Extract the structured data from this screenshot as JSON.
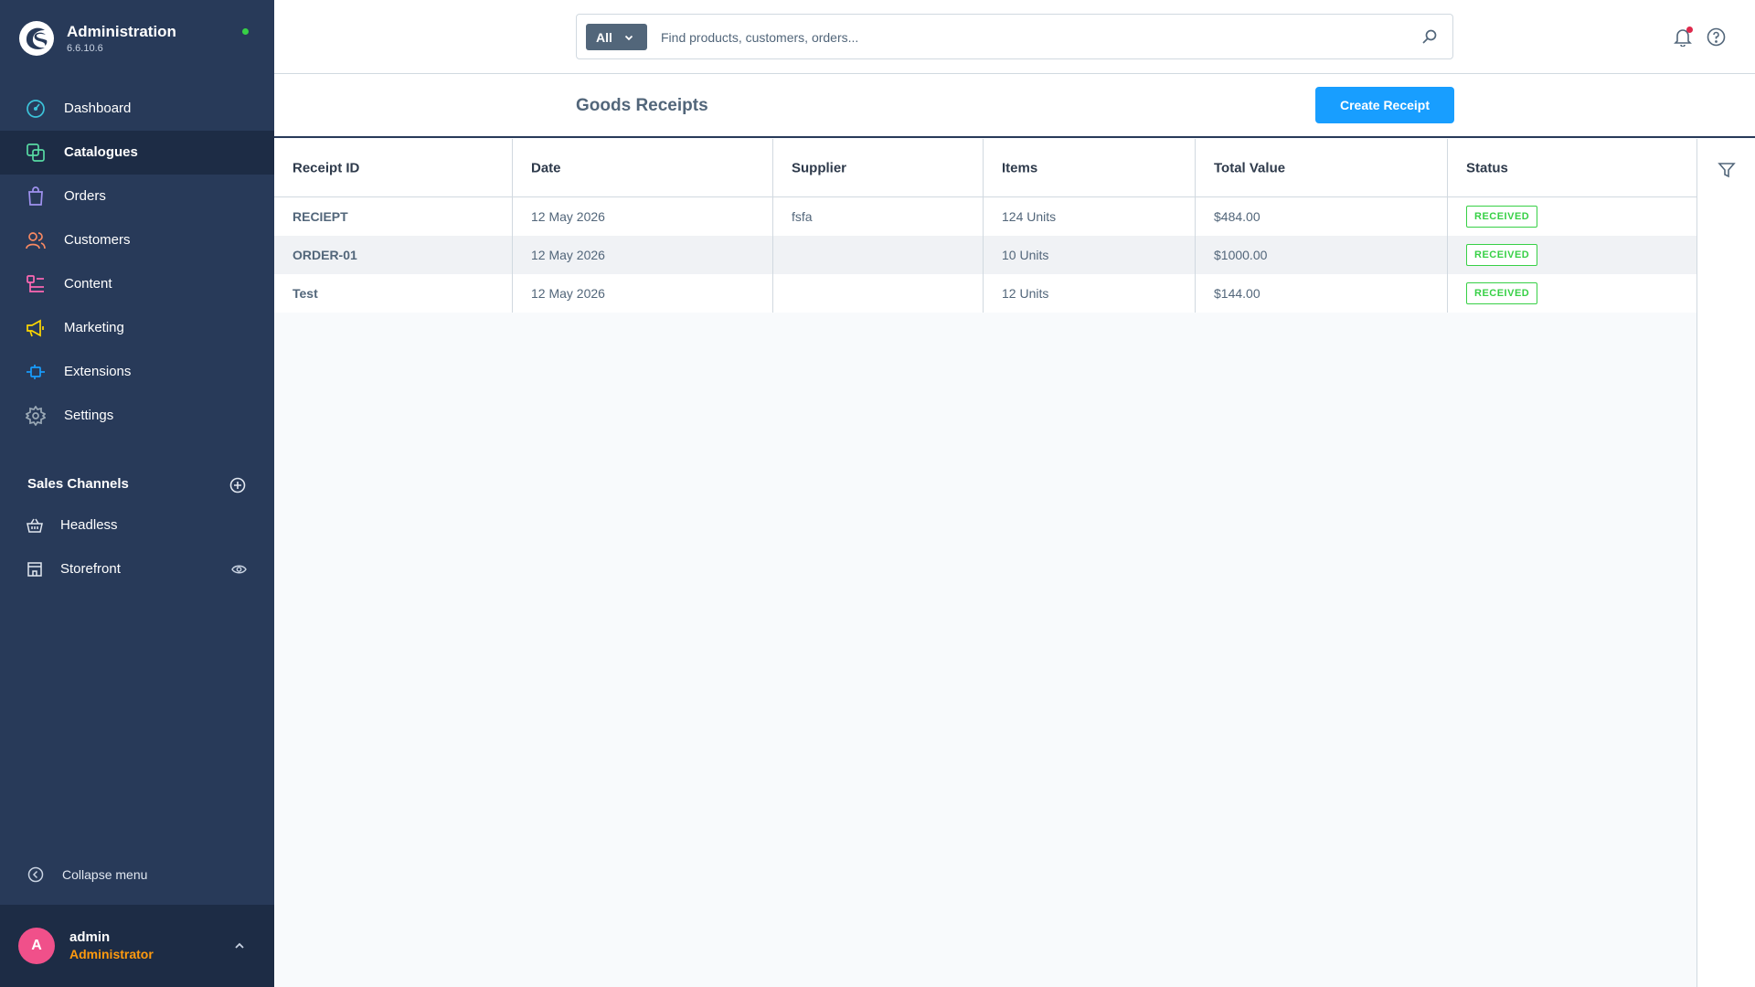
{
  "brand": {
    "title": "Administration",
    "version": "6.6.10.6",
    "status_color": "#37d046"
  },
  "sidebar": {
    "items": [
      {
        "label": "Dashboard",
        "icon": "dashboard-icon",
        "color": "#3cc2d9"
      },
      {
        "label": "Catalogues",
        "icon": "catalogue-icon",
        "color": "#57d9a3",
        "active": true
      },
      {
        "label": "Orders",
        "icon": "orders-icon",
        "color": "#a092f0"
      },
      {
        "label": "Customers",
        "icon": "customers-icon",
        "color": "#f88962"
      },
      {
        "label": "Content",
        "icon": "content-icon",
        "color": "#ff68b4"
      },
      {
        "label": "Marketing",
        "icon": "marketing-icon",
        "color": "#ffd700"
      },
      {
        "label": "Extensions",
        "icon": "extensions-icon",
        "color": "#189eff"
      },
      {
        "label": "Settings",
        "icon": "settings-icon",
        "color": "#9aa8b5"
      }
    ],
    "sales_channels": {
      "title": "Sales Channels",
      "items": [
        {
          "label": "Headless",
          "icon": "basket-icon"
        },
        {
          "label": "Storefront",
          "icon": "storefront-icon"
        }
      ]
    },
    "collapse_label": "Collapse menu",
    "user": {
      "initial": "A",
      "name": "admin",
      "role": "Administrator"
    }
  },
  "search": {
    "type_label": "All",
    "placeholder": "Find products, customers, orders..."
  },
  "page": {
    "title": "Goods Receipts",
    "create_label": "Create Receipt"
  },
  "table": {
    "columns": [
      "Receipt ID",
      "Date",
      "Supplier",
      "Items",
      "Total Value",
      "Status"
    ],
    "rows": [
      {
        "id": "RECIEPT",
        "date": "12 May 2026",
        "supplier": "fsfa",
        "items": "124 Units",
        "total": "$484.00",
        "status": "RECEIVED"
      },
      {
        "id": "ORDER-01",
        "date": "12 May 2026",
        "supplier": "",
        "items": "10 Units",
        "total": "$1000.00",
        "status": "RECEIVED"
      },
      {
        "id": "Test",
        "date": "12 May 2026",
        "supplier": "",
        "items": "12 Units",
        "total": "$144.00",
        "status": "RECEIVED"
      }
    ]
  },
  "colors": {
    "sidebar_bg": "#283a59",
    "accent": "#189eff",
    "success": "#37d046",
    "role": "#ff9a0e",
    "avatar": "#f0508a"
  }
}
